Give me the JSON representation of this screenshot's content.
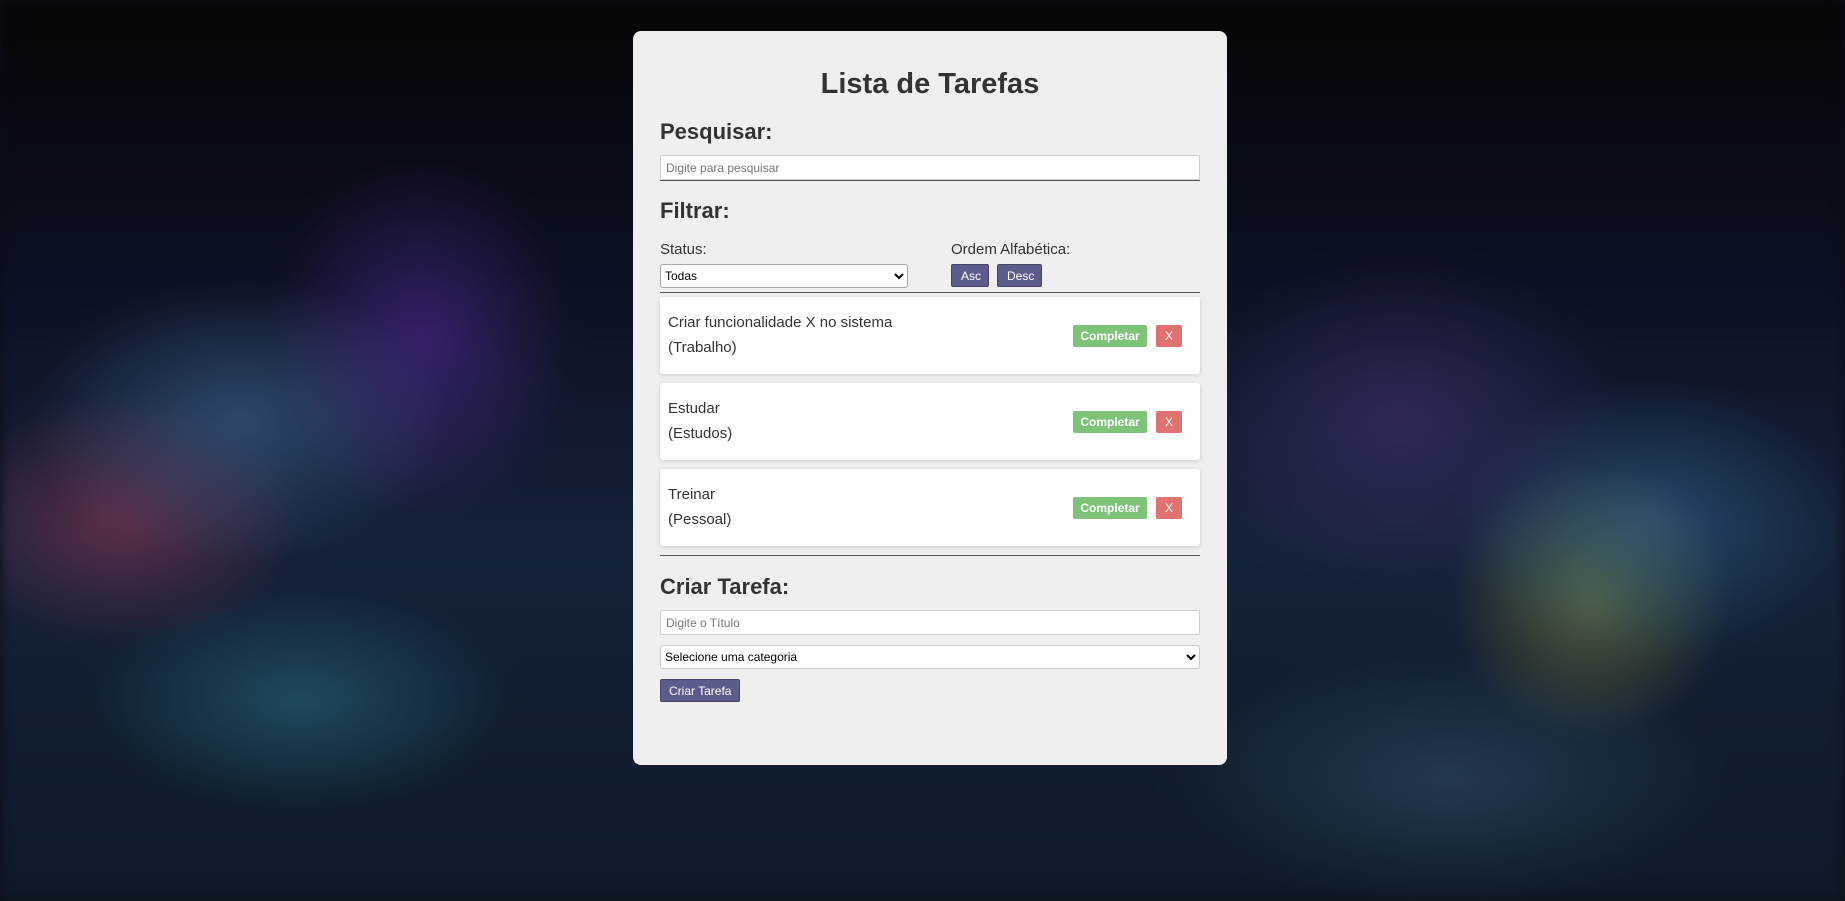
{
  "page": {
    "title": "Lista de Tarefas"
  },
  "search": {
    "heading": "Pesquisar:",
    "placeholder": "Digite para pesquisar",
    "value": ""
  },
  "filter": {
    "heading": "Filtrar:",
    "status_label": "Status:",
    "status_selected": "Todas",
    "order_label": "Ordem Alfabética:",
    "asc_label": "Asc",
    "desc_label": "Desc"
  },
  "tasks": [
    {
      "title": "Criar funcionalidade X no sistema",
      "category": "(Trabalho)",
      "complete_label": "Completar",
      "remove_label": "X"
    },
    {
      "title": "Estudar",
      "category": "(Estudos)",
      "complete_label": "Completar",
      "remove_label": "X"
    },
    {
      "title": "Treinar",
      "category": "(Pessoal)",
      "complete_label": "Completar",
      "remove_label": "X"
    }
  ],
  "create": {
    "heading": "Criar Tarefa:",
    "title_placeholder": "Digite o Título",
    "category_selected": "Selecione uma categoria",
    "submit_label": "Criar Tarefa"
  },
  "colors": {
    "accent": "#5c5c8c",
    "complete": "#7dc479",
    "remove": "#e07272",
    "card_background": "#efefef"
  }
}
